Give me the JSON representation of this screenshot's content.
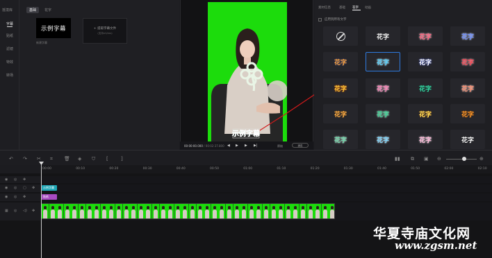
{
  "left_nav": {
    "header": "抵境库",
    "items": [
      "字幕",
      "贴纸",
      "滤镜",
      "特效",
      "转场"
    ]
  },
  "panel": {
    "tabs": [
      "基础",
      "花字"
    ],
    "card1_text": "示例字幕",
    "card2_line1": "+ 提取字幕文件",
    "card2_line2": "(支持srt/ass)",
    "card1_caption": "新建字幕"
  },
  "viewer": {
    "overlay_text": "示例字幕",
    "timecode_current": "00:00:00.000",
    "timecode_total": "/ 00:02:37.800",
    "ratio_label": "原始",
    "fit_label": "适应"
  },
  "right_panel": {
    "tabs": [
      "素材信息",
      "基础",
      "花字",
      "动画"
    ],
    "checkbox_label": "应用到所有文字",
    "tile_text": "花字",
    "tiles": [
      {
        "style": "none",
        "color": "#e3e3e3",
        "shadow": "none"
      },
      {
        "style": "text",
        "color": "#ffffff",
        "shadow": "0 0 1px #000"
      },
      {
        "style": "text",
        "color": "#ff5d7a",
        "shadow": "0 0 2px #fff"
      },
      {
        "style": "text",
        "color": "#6a8cff",
        "shadow": "0 0 2px #fff"
      },
      {
        "style": "text",
        "color": "#ffa53a",
        "shadow": "0 0 2px #2a3b8c"
      },
      {
        "style": "text",
        "color": "#4ed0ff",
        "shadow": "0 0 2px #fff"
      },
      {
        "style": "text",
        "color": "#ffffff",
        "shadow": "0 0 2px #3c52d8"
      },
      {
        "style": "text",
        "color": "#ff3a4a",
        "shadow": "0 0 2px #fff"
      },
      {
        "style": "text",
        "color": "#ffcb3a",
        "shadow": "0 0 2px #d24a00"
      },
      {
        "style": "text",
        "color": "#ff7eb6",
        "shadow": "0 0 2px #fff"
      },
      {
        "style": "text",
        "color": "#36d3a0",
        "shadow": "0 0 1px #0b5a46"
      },
      {
        "style": "text",
        "color": "#ff8a6a",
        "shadow": "0 0 2px #fff"
      },
      {
        "style": "text",
        "color": "#ffb04a",
        "shadow": "0 0 1px #6b3b00"
      },
      {
        "style": "text",
        "color": "#2fd38f",
        "shadow": "0 0 2px #fff"
      },
      {
        "style": "text",
        "color": "#ffe35a",
        "shadow": "0 0 1px #b54200"
      },
      {
        "style": "text",
        "color": "#ff9a2a",
        "shadow": "0 0 1px #6b2b00"
      },
      {
        "style": "text",
        "color": "#6ad8a8",
        "shadow": "0 0 2px #fff"
      },
      {
        "style": "text",
        "color": "#7ad6ff",
        "shadow": "0 0 2px #fff"
      },
      {
        "style": "text",
        "color": "#ffb8d8",
        "shadow": "0 0 2px #fff"
      },
      {
        "style": "text",
        "color": "#ffffff",
        "shadow": "0 0 1px #000"
      }
    ]
  },
  "ruler": [
    "00:00",
    "00:10",
    "00:20",
    "00:30",
    "00:40",
    "00:50",
    "01:00",
    "01:10",
    "01:20",
    "01:30",
    "01:40",
    "01:50",
    "02:00",
    "02:10"
  ],
  "timeline": {
    "subtitle_clip": "示例字幕",
    "effect_clip": "贴纸"
  },
  "watermark": {
    "line1": "华夏寺庙文化网",
    "line2": "www.zgsm.net"
  }
}
